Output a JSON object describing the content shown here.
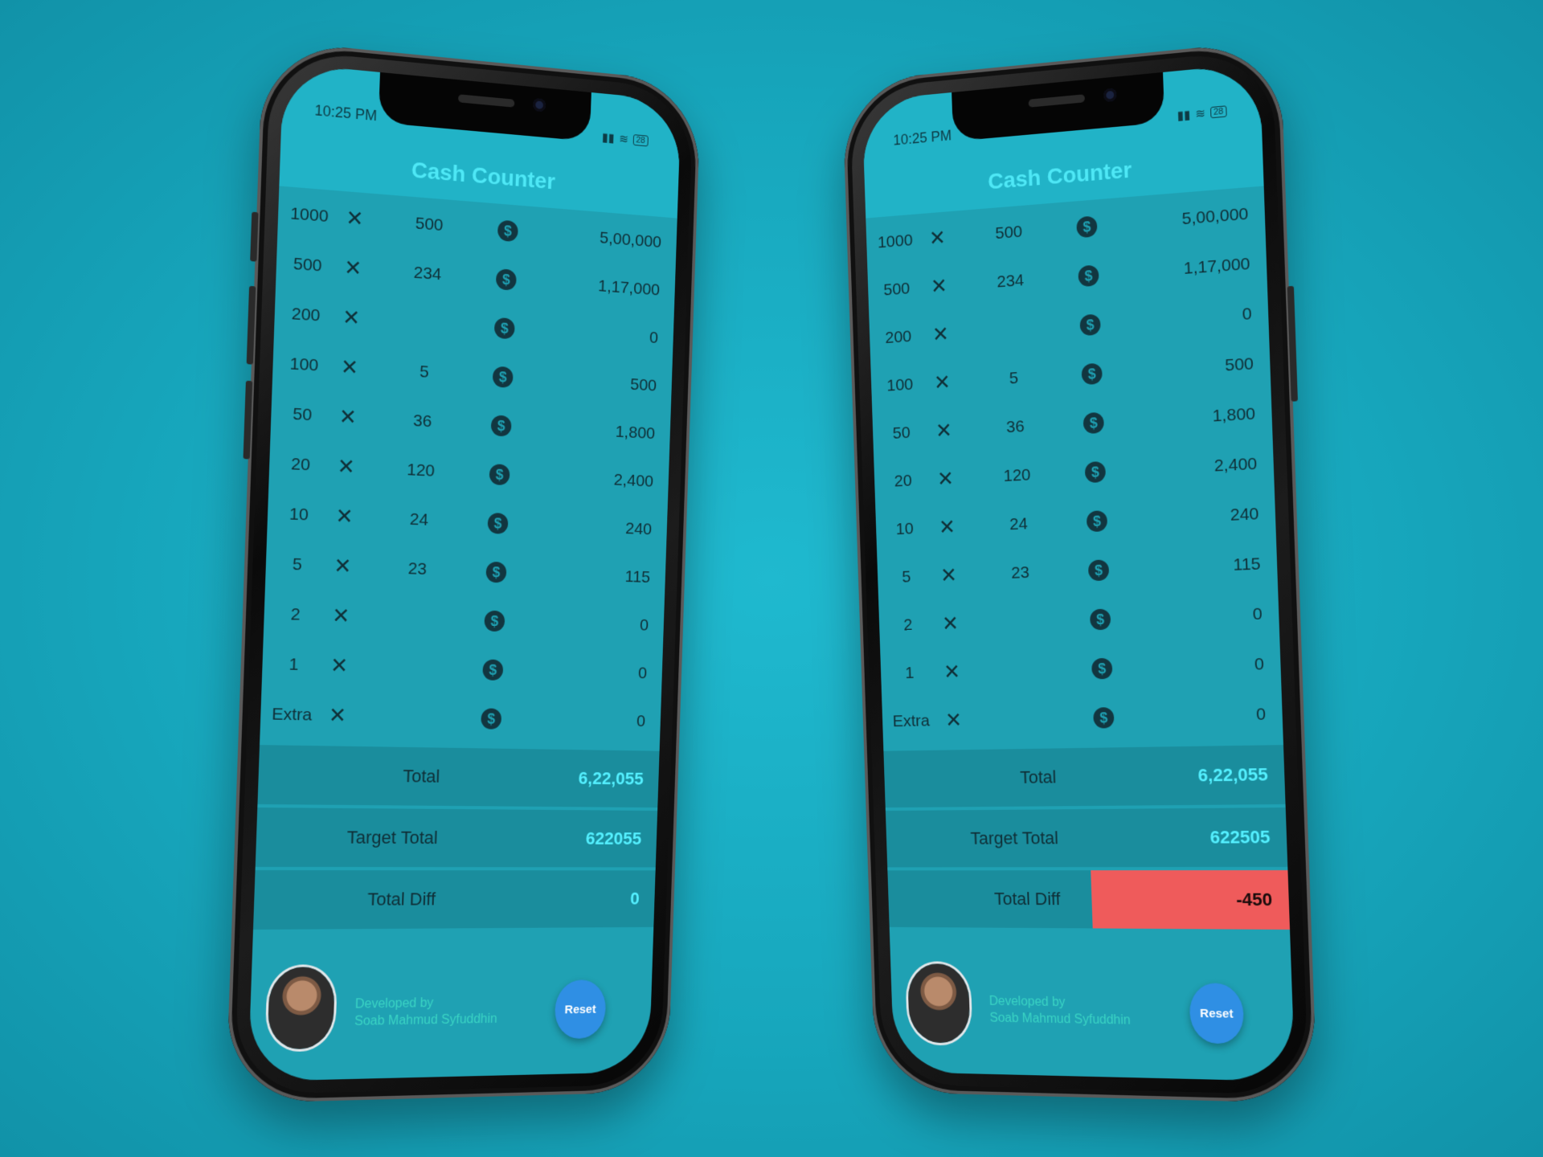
{
  "status_time": "10:25 PM",
  "battery": "28",
  "app_title": "Cash Counter",
  "coin_glyph": "$",
  "times_glyph": "✕",
  "phones": [
    {
      "rows": [
        {
          "den": "1000",
          "qty": "500",
          "amount": "5,00,000"
        },
        {
          "den": "500",
          "qty": "234",
          "amount": "1,17,000"
        },
        {
          "den": "200",
          "qty": "",
          "amount": "0"
        },
        {
          "den": "100",
          "qty": "5",
          "amount": "500"
        },
        {
          "den": "50",
          "qty": "36",
          "amount": "1,800"
        },
        {
          "den": "20",
          "qty": "120",
          "amount": "2,400"
        },
        {
          "den": "10",
          "qty": "24",
          "amount": "240"
        },
        {
          "den": "5",
          "qty": "23",
          "amount": "115"
        },
        {
          "den": "2",
          "qty": "",
          "amount": "0"
        },
        {
          "den": "1",
          "qty": "",
          "amount": "0"
        },
        {
          "den": "Extra",
          "qty": "",
          "amount": "0"
        }
      ],
      "total_label": "Total",
      "total_value": "6,22,055",
      "target_label": "Target Total",
      "target_value": "622055",
      "diff_label": "Total Diff",
      "diff_value": "0",
      "developed_by": "Developed by",
      "developer": "Soab Mahmud Syfuddhin",
      "reset": "Reset"
    },
    {
      "rows": [
        {
          "den": "1000",
          "qty": "500",
          "amount": "5,00,000"
        },
        {
          "den": "500",
          "qty": "234",
          "amount": "1,17,000"
        },
        {
          "den": "200",
          "qty": "",
          "amount": "0"
        },
        {
          "den": "100",
          "qty": "5",
          "amount": "500"
        },
        {
          "den": "50",
          "qty": "36",
          "amount": "1,800"
        },
        {
          "den": "20",
          "qty": "120",
          "amount": "2,400"
        },
        {
          "den": "10",
          "qty": "24",
          "amount": "240"
        },
        {
          "den": "5",
          "qty": "23",
          "amount": "115"
        },
        {
          "den": "2",
          "qty": "",
          "amount": "0"
        },
        {
          "den": "1",
          "qty": "",
          "amount": "0"
        },
        {
          "den": "Extra",
          "qty": "",
          "amount": "0"
        }
      ],
      "total_label": "Total",
      "total_value": "6,22,055",
      "target_label": "Target Total",
      "target_value": "622505",
      "diff_label": "Total Diff",
      "diff_value": "-450",
      "developed_by": "Developed by",
      "developer": "Soab Mahmud Syfuddhin",
      "reset": "Reset"
    }
  ],
  "colors": {
    "background": "#1cb3c9",
    "app_bar": "#21b3c7",
    "title": "#4ee8f6",
    "value_accent": "#54f0ff",
    "diff_negative": "#ef5b5b",
    "reset_button": "#2f8fe4"
  }
}
